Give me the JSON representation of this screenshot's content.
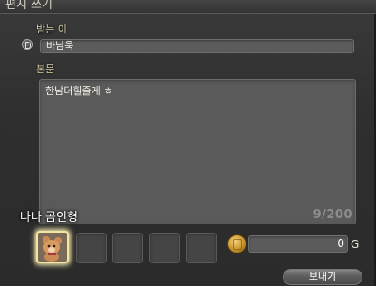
{
  "window": {
    "title": "편지 쓰기"
  },
  "recipient": {
    "label": "받는 이",
    "value": "바남욱",
    "icon": "linkshell-icon"
  },
  "body": {
    "label": "본문",
    "text": "한남더힐줄게 ㅎ",
    "char_count": "9/200"
  },
  "attachments": {
    "tooltip": "나나 곰인형",
    "slots": [
      {
        "item": "bear-doll-icon",
        "filled": true
      },
      {
        "filled": false
      },
      {
        "filled": false
      },
      {
        "filled": false
      },
      {
        "filled": false
      }
    ]
  },
  "gil": {
    "value": "0",
    "unit": "G",
    "icon": "gil-coin-icon"
  },
  "send_button": {
    "label": "보내기"
  }
}
